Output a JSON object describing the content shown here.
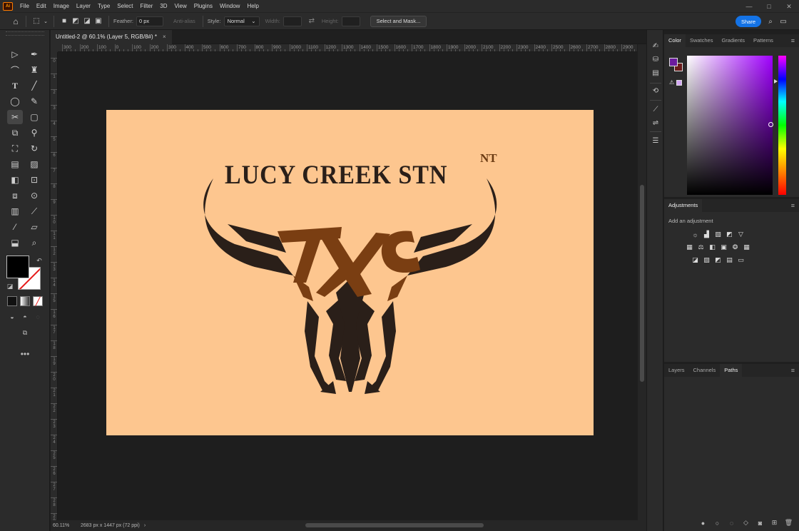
{
  "app": {
    "logo_text": "Ai",
    "menu": [
      "File",
      "Edit",
      "Image",
      "Layer",
      "Type",
      "Select",
      "Filter",
      "3D",
      "View",
      "Plugins",
      "Window",
      "Help"
    ],
    "window_controls": [
      "—",
      "□",
      "✕"
    ]
  },
  "options": {
    "feather_label": "Feather:",
    "feather_value": "0 px",
    "anti_alias_label": "Anti-alias",
    "style_label": "Style:",
    "style_value": "Normal",
    "width_label": "Width:",
    "height_label": "Height:",
    "select_mask_label": "Select and Mask...",
    "share_label": "Share"
  },
  "document": {
    "tab_title": "Untitled-2 @ 60.1% (Layer 5, RGB/8#) *",
    "close_glyph": "×",
    "zoom": "60.11%",
    "info": "2683 px x 1447 px (72 ppi)",
    "info_arrow": "›"
  },
  "ruler": {
    "top_labels": [
      "300",
      "200",
      "100",
      "0",
      "100",
      "200",
      "300",
      "400",
      "500",
      "600",
      "700",
      "800",
      "900",
      "1000",
      "1100",
      "1200",
      "1300",
      "1400",
      "1500",
      "1600",
      "1700",
      "1800",
      "1900",
      "2000",
      "2100",
      "2200",
      "2300",
      "2400",
      "2500",
      "2600",
      "2700",
      "2800",
      "2900"
    ],
    "left_labels": [
      "0",
      "1",
      "2",
      "3",
      "4",
      "5",
      "6",
      "7",
      "8",
      "9",
      "1 0",
      "1 1",
      "1 2",
      "1 3",
      "1 4",
      "1 5",
      "1 6",
      "1 7",
      "1 8",
      "1 9",
      "2 0",
      "2 1",
      "2 2",
      "2 3",
      "2 4",
      "2 5",
      "2 6",
      "2 7",
      "2 8",
      "2 9"
    ]
  },
  "artwork": {
    "title": "LUCY CREEK STN",
    "superscript": "NT",
    "monogram": "TXC",
    "colors": {
      "background": "#fdc68f",
      "dark": "#2a1f19",
      "brown": "#7a3e12"
    }
  },
  "panels": {
    "color_tabs": [
      "Color",
      "Swatches",
      "Gradients",
      "Patterns"
    ],
    "adjustments_title": "Adjustments",
    "adjustments_hint": "Add an adjustment",
    "layer_tabs": [
      "Layers",
      "Channels",
      "Paths"
    ],
    "active_layer_tab": "Paths",
    "foreground_color": "#6c1b9e",
    "background_color": "#6b1b1b"
  },
  "icons": {
    "tools": [
      "move-icon",
      "pen-icon",
      "curvature-icon",
      "stamp-icon",
      "type-icon",
      "line-icon",
      "ellipse-icon",
      "pencil-icon",
      "scissors-icon",
      "rectangle-icon",
      "crop-icon",
      "warp-icon",
      "perspective-icon",
      "lasso-icon",
      "gradient-icon",
      "eraser-icon",
      "brush-icon",
      "patch-icon",
      "histogram-icon",
      "eyedropper-icon",
      "color-sampler-icon",
      "edit-icon",
      "extrude-icon",
      "zoom-icon",
      "more-icon"
    ]
  }
}
